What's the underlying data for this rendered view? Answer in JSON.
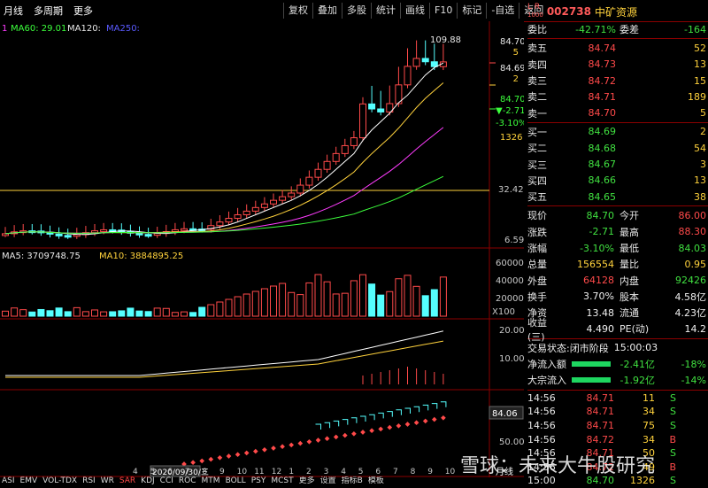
{
  "toolbar": {
    "tab_daily": "月线",
    "tab_multi": "多周期",
    "more": "更多",
    "buttons": [
      "复权",
      "叠加",
      "多股",
      "统计",
      "画线",
      "F10",
      "标记",
      "-自选",
      "返回"
    ]
  },
  "stock": {
    "code": "002738",
    "name": "中矿资源",
    "lr_top": "L",
    "lr_bottom": "R",
    "lr_sub": "1000"
  },
  "ma_legend": {
    "prefix": "1",
    "ma60": "MA60: 29.01",
    "ma120": "MA120:",
    "ma250": "MA250:"
  },
  "price_labels": {
    "high": "109.88",
    "p1": "84.70",
    "p2": "5",
    "p3": "84.69",
    "p4": "2",
    "p5": "84.70",
    "p6": "▼-2.71",
    "p7": "-3.10%",
    "p8": "1326",
    "level": "32.42",
    "low": "6.59"
  },
  "vol_legend": {
    "ma5": "MA5: 3709748.75",
    "ma10": "MA10: 3884895.25"
  },
  "vol_axis": [
    "60000",
    "40000",
    "20000",
    "X100"
  ],
  "macd_axis": [
    "20.00",
    "10.00"
  ],
  "bottom_axis": {
    "val": "84.06",
    "lvl": "50.00",
    "date": "2020/09/30/三",
    "xticks": [
      "4",
      "5",
      "6",
      "7",
      "8",
      "9",
      "10",
      "11",
      "12",
      "1",
      "2",
      "3",
      "4",
      "5",
      "6",
      "7",
      "8",
      "9",
      "10"
    ],
    "unit": "月线"
  },
  "bottom_tabs": [
    "ASI",
    "EMV",
    "VOL-TDX",
    "RSI",
    "WR",
    "SAR",
    "KDJ",
    "CCI",
    "ROC",
    "MTM",
    "BOLL",
    "PSY",
    "MCST",
    "更多",
    "设置",
    "指标B",
    "模板"
  ],
  "order_book": {
    "wei_bi_label": "委比",
    "wei_bi": "-42.71%",
    "wei_cha_label": "委差",
    "wei_cha": "-164",
    "sell": [
      {
        "l": "卖五",
        "p": "84.74",
        "v": "52"
      },
      {
        "l": "卖四",
        "p": "84.73",
        "v": "13"
      },
      {
        "l": "卖三",
        "p": "84.72",
        "v": "15"
      },
      {
        "l": "卖二",
        "p": "84.71",
        "v": "189"
      },
      {
        "l": "卖一",
        "p": "84.70",
        "v": "5"
      }
    ],
    "buy": [
      {
        "l": "买一",
        "p": "84.69",
        "v": "2"
      },
      {
        "l": "买二",
        "p": "84.68",
        "v": "54"
      },
      {
        "l": "买三",
        "p": "84.67",
        "v": "3"
      },
      {
        "l": "买四",
        "p": "84.66",
        "v": "13"
      },
      {
        "l": "买五",
        "p": "84.65",
        "v": "38"
      }
    ]
  },
  "stats": [
    {
      "l1": "现价",
      "v1": "84.70",
      "c1": "green",
      "l2": "今开",
      "v2": "86.00",
      "c2": "red"
    },
    {
      "l1": "涨跌",
      "v1": "-2.71",
      "c1": "green",
      "l2": "最高",
      "v2": "88.30",
      "c2": "red"
    },
    {
      "l1": "涨幅",
      "v1": "-3.10%",
      "c1": "green",
      "l2": "最低",
      "v2": "84.03",
      "c2": "green"
    },
    {
      "l1": "总量",
      "v1": "156554",
      "c1": "yellow",
      "l2": "量比",
      "v2": "0.95",
      "c2": "yellow"
    },
    {
      "l1": "外盘",
      "v1": "64128",
      "c1": "red",
      "l2": "内盘",
      "v2": "92426",
      "c2": "green"
    },
    {
      "l1": "换手",
      "v1": "3.70%",
      "c1": "white",
      "l2": "股本",
      "v2": "4.58亿",
      "c2": "white"
    },
    {
      "l1": "净资",
      "v1": "13.48",
      "c1": "white",
      "l2": "流通",
      "v2": "4.23亿",
      "c2": "white"
    },
    {
      "l1": "收益(三)",
      "v1": "4.490",
      "c1": "white",
      "l2": "PE(动)",
      "v2": "14.2",
      "c2": "white"
    }
  ],
  "trade_status": {
    "label": "交易状态:",
    "phase": "闭市阶段",
    "time": "15:00:03"
  },
  "flows": [
    {
      "l": "净流入额",
      "v": "-2.41亿",
      "p": "-18%"
    },
    {
      "l": "大宗流入",
      "v": "-1.92亿",
      "p": "-14%"
    }
  ],
  "ticks": [
    {
      "t": "14:56",
      "p": "84.71",
      "v": "11",
      "d": "S"
    },
    {
      "t": "14:56",
      "p": "84.71",
      "v": "34",
      "d": "S"
    },
    {
      "t": "14:56",
      "p": "84.71",
      "v": "75",
      "d": "S"
    },
    {
      "t": "14:56",
      "p": "84.72",
      "v": "34",
      "d": "B"
    },
    {
      "t": "14:56",
      "p": "84.71",
      "v": "50",
      "d": "S"
    },
    {
      "t": "14:56",
      "p": "84.72",
      "v": "49",
      "d": "B"
    },
    {
      "t": "15:00",
      "p": "84.70",
      "v": "1326",
      "d": "S"
    }
  ],
  "watermark": "雪球：未来大牛股研究",
  "colors": {
    "up": "#ff4a4a",
    "down": "#55ffff",
    "ma5": "#ffffff",
    "ma10": "#ffd23c",
    "ma20": "#ff3cff",
    "ma60": "#3cff3c",
    "border": "#8b0000"
  }
}
